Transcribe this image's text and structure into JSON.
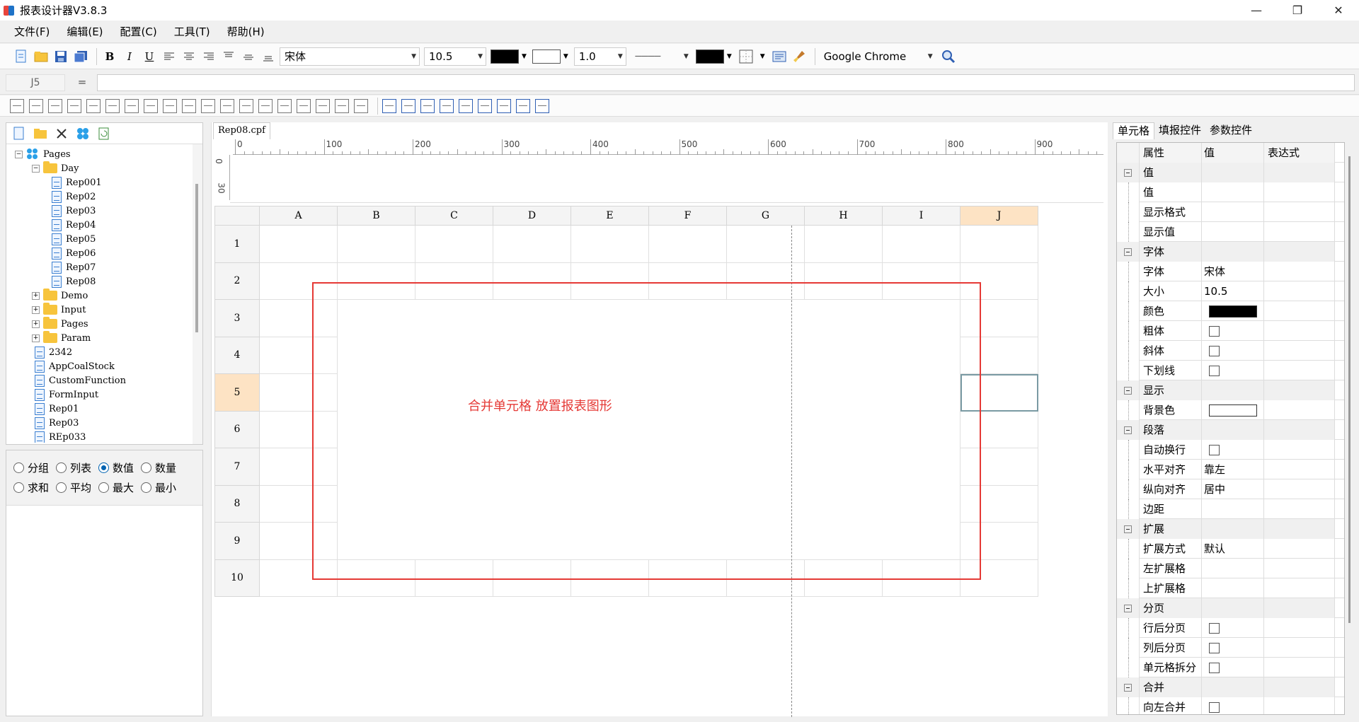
{
  "window": {
    "title": "报表设计器V3.8.3",
    "controls": [
      "—",
      "❐",
      "✕"
    ]
  },
  "menu": [
    "文件(F)",
    "编辑(E)",
    "配置(C)",
    "工具(T)",
    "帮助(H)"
  ],
  "toolbar": {
    "font_name": "宋体",
    "font_size": "10.5",
    "text_color": "#000000",
    "fill_color": "#ffffff",
    "line_width": "1.0",
    "line_style": "————",
    "line_color": "#000000",
    "browser": "Google Chrome",
    "icons": [
      "new-file-icon",
      "open-folder-icon",
      "save-icon",
      "save-all-icon",
      "bold-icon",
      "italic-icon",
      "underline-icon",
      "align-left-icon",
      "align-center-icon",
      "align-right-icon",
      "valign-top-icon",
      "valign-middle-icon",
      "valign-bottom-icon",
      "border-icon",
      "preview-icon",
      "brush-icon",
      "search-icon"
    ],
    "bold": "B",
    "italic": "I",
    "underline": "U"
  },
  "formula": {
    "cell_ref": "J5",
    "equals": "=",
    "value": ""
  },
  "tree": {
    "toolbar_icons": [
      "new-report-icon",
      "new-folder-icon",
      "delete-icon",
      "pages-icon",
      "refresh-icon"
    ],
    "items": [
      {
        "label": "Pages",
        "level": 0,
        "kind": "root",
        "toggle": "−"
      },
      {
        "label": "Day",
        "level": 1,
        "kind": "folder",
        "toggle": "−"
      },
      {
        "label": "Rep001",
        "level": 2,
        "kind": "file"
      },
      {
        "label": "Rep02",
        "level": 2,
        "kind": "file"
      },
      {
        "label": "Rep03",
        "level": 2,
        "kind": "file"
      },
      {
        "label": "Rep04",
        "level": 2,
        "kind": "file"
      },
      {
        "label": "Rep05",
        "level": 2,
        "kind": "file"
      },
      {
        "label": "Rep06",
        "level": 2,
        "kind": "file"
      },
      {
        "label": "Rep07",
        "level": 2,
        "kind": "file"
      },
      {
        "label": "Rep08",
        "level": 2,
        "kind": "file"
      },
      {
        "label": "Demo",
        "level": 1,
        "kind": "folder",
        "toggle": "+"
      },
      {
        "label": "Input",
        "level": 1,
        "kind": "folder",
        "toggle": "+"
      },
      {
        "label": "Pages",
        "level": 1,
        "kind": "folder",
        "toggle": "+"
      },
      {
        "label": "Param",
        "level": 1,
        "kind": "folder",
        "toggle": "+"
      },
      {
        "label": "2342",
        "level": 1,
        "kind": "file"
      },
      {
        "label": "AppCoalStock",
        "level": 1,
        "kind": "file"
      },
      {
        "label": "CustomFunction",
        "level": 1,
        "kind": "file"
      },
      {
        "label": "FormInput",
        "level": 1,
        "kind": "file"
      },
      {
        "label": "Rep01",
        "level": 1,
        "kind": "file"
      },
      {
        "label": "Rep03",
        "level": 1,
        "kind": "file"
      },
      {
        "label": "REp033",
        "level": 1,
        "kind": "file"
      }
    ]
  },
  "options": {
    "row1": [
      {
        "label": "分组",
        "checked": false
      },
      {
        "label": "列表",
        "checked": false
      },
      {
        "label": "数值",
        "checked": true
      },
      {
        "label": "数量",
        "checked": false
      }
    ],
    "row2": [
      {
        "label": "求和",
        "checked": false
      },
      {
        "label": "平均",
        "checked": false
      },
      {
        "label": "最大",
        "checked": false
      },
      {
        "label": "最小",
        "checked": false
      }
    ]
  },
  "designer": {
    "tab": "Rep08.cpf",
    "ruler_h": [
      "0",
      "100",
      "200",
      "300",
      "400",
      "500",
      "600",
      "700",
      "800",
      "900"
    ],
    "ruler_v": [
      "0",
      "30"
    ],
    "columns": [
      "A",
      "B",
      "C",
      "D",
      "E",
      "F",
      "G",
      "H",
      "I",
      "J"
    ],
    "rows": [
      "1",
      "2",
      "3",
      "4",
      "5",
      "6",
      "7",
      "8",
      "9",
      "10"
    ],
    "selected_col": "J",
    "selected_row": "5",
    "merged_note": "合并单元格 放置报表图形",
    "highlight_color": "#e53935"
  },
  "props": {
    "tabs": [
      "单元格",
      "填报控件",
      "参数控件"
    ],
    "headers": [
      "属性",
      "值",
      "表达式"
    ],
    "rows": [
      {
        "type": "group",
        "name": "值"
      },
      {
        "type": "text",
        "name": "值",
        "value": ""
      },
      {
        "type": "text",
        "name": "显示格式",
        "value": ""
      },
      {
        "type": "text",
        "name": "显示值",
        "value": ""
      },
      {
        "type": "group",
        "name": "字体"
      },
      {
        "type": "text",
        "name": "字体",
        "value": "宋体"
      },
      {
        "type": "text",
        "name": "大小",
        "value": "10.5"
      },
      {
        "type": "color",
        "name": "颜色",
        "value": "#000000"
      },
      {
        "type": "check",
        "name": "粗体"
      },
      {
        "type": "check",
        "name": "斜体"
      },
      {
        "type": "check",
        "name": "下划线"
      },
      {
        "type": "group",
        "name": "显示"
      },
      {
        "type": "color",
        "name": "背景色",
        "value": "#ffffff"
      },
      {
        "type": "group",
        "name": "段落"
      },
      {
        "type": "check",
        "name": "自动换行"
      },
      {
        "type": "text",
        "name": "水平对齐",
        "value": "靠左"
      },
      {
        "type": "text",
        "name": "纵向对齐",
        "value": "居中"
      },
      {
        "type": "text",
        "name": "边距",
        "value": ""
      },
      {
        "type": "group",
        "name": "扩展"
      },
      {
        "type": "text",
        "name": "扩展方式",
        "value": "默认"
      },
      {
        "type": "text",
        "name": "左扩展格",
        "value": ""
      },
      {
        "type": "text",
        "name": "上扩展格",
        "value": ""
      },
      {
        "type": "group",
        "name": "分页"
      },
      {
        "type": "check",
        "name": "行后分页"
      },
      {
        "type": "check",
        "name": "列后分页"
      },
      {
        "type": "check",
        "name": "单元格拆分"
      },
      {
        "type": "group",
        "name": "合并"
      },
      {
        "type": "check",
        "name": "向左合并"
      }
    ]
  }
}
